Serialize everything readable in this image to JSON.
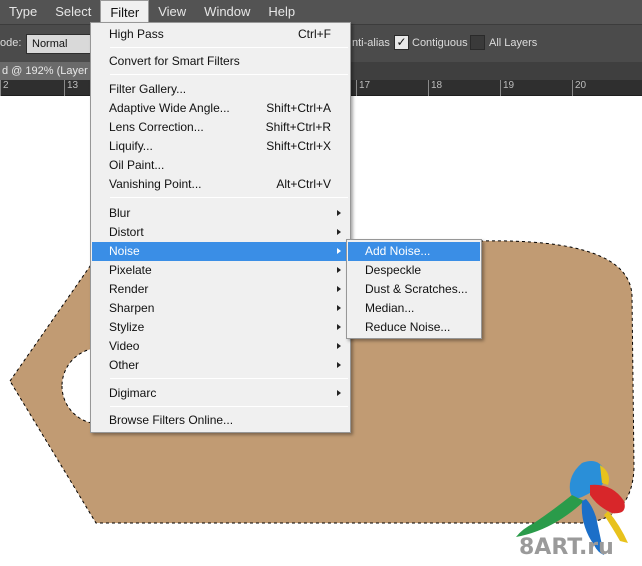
{
  "menubar": {
    "items": [
      {
        "label": "Type",
        "active": false
      },
      {
        "label": "Select",
        "active": false
      },
      {
        "label": "Filter",
        "active": true
      },
      {
        "label": "View",
        "active": false
      },
      {
        "label": "Window",
        "active": false
      },
      {
        "label": "Help",
        "active": false
      }
    ]
  },
  "options": {
    "mode_label": "ode:",
    "mode_value": "Normal",
    "anti_alias_label": "nti-alias",
    "contiguous_label": "Contiguous",
    "contiguous_checked": true,
    "all_layers_label": "All Layers",
    "all_layers_checked": false
  },
  "document": {
    "tab_title": "d @ 192% (Layer"
  },
  "ruler": {
    "ticks": [
      "2",
      "13",
      "17",
      "18",
      "19",
      "20"
    ]
  },
  "filter_menu": {
    "items": [
      {
        "label": "High Pass",
        "shortcut": "Ctrl+F"
      },
      {
        "label": "Convert for Smart Filters",
        "shortcut": ""
      },
      {
        "label": "Filter Gallery...",
        "shortcut": ""
      },
      {
        "label": "Adaptive Wide Angle...",
        "shortcut": "Shift+Ctrl+A"
      },
      {
        "label": "Lens Correction...",
        "shortcut": "Shift+Ctrl+R"
      },
      {
        "label": "Liquify...",
        "shortcut": "Shift+Ctrl+X"
      },
      {
        "label": "Oil Paint...",
        "shortcut": ""
      },
      {
        "label": "Vanishing Point...",
        "shortcut": "Alt+Ctrl+V"
      },
      {
        "label": "Blur",
        "submenu": true
      },
      {
        "label": "Distort",
        "submenu": true
      },
      {
        "label": "Noise",
        "submenu": true,
        "highlighted": true
      },
      {
        "label": "Pixelate",
        "submenu": true
      },
      {
        "label": "Render",
        "submenu": true
      },
      {
        "label": "Sharpen",
        "submenu": true
      },
      {
        "label": "Stylize",
        "submenu": true
      },
      {
        "label": "Video",
        "submenu": true
      },
      {
        "label": "Other",
        "submenu": true
      },
      {
        "label": "Digimarc",
        "submenu": true
      },
      {
        "label": "Browse Filters Online...",
        "shortcut": ""
      }
    ]
  },
  "noise_submenu": {
    "items": [
      {
        "label": "Add Noise...",
        "highlighted": true
      },
      {
        "label": "Despeckle"
      },
      {
        "label": "Dust & Scratches..."
      },
      {
        "label": "Median..."
      },
      {
        "label": "Reduce Noise..."
      }
    ]
  },
  "canvas": {
    "tag_fill": "#c19b73"
  },
  "colors": {
    "menubar_bg": "#535353",
    "menu_bg": "#f0f0f0",
    "highlight": "#3a8ee6",
    "tag_fill": "#c19b73"
  },
  "watermark": {
    "text": "8ART.ru"
  }
}
